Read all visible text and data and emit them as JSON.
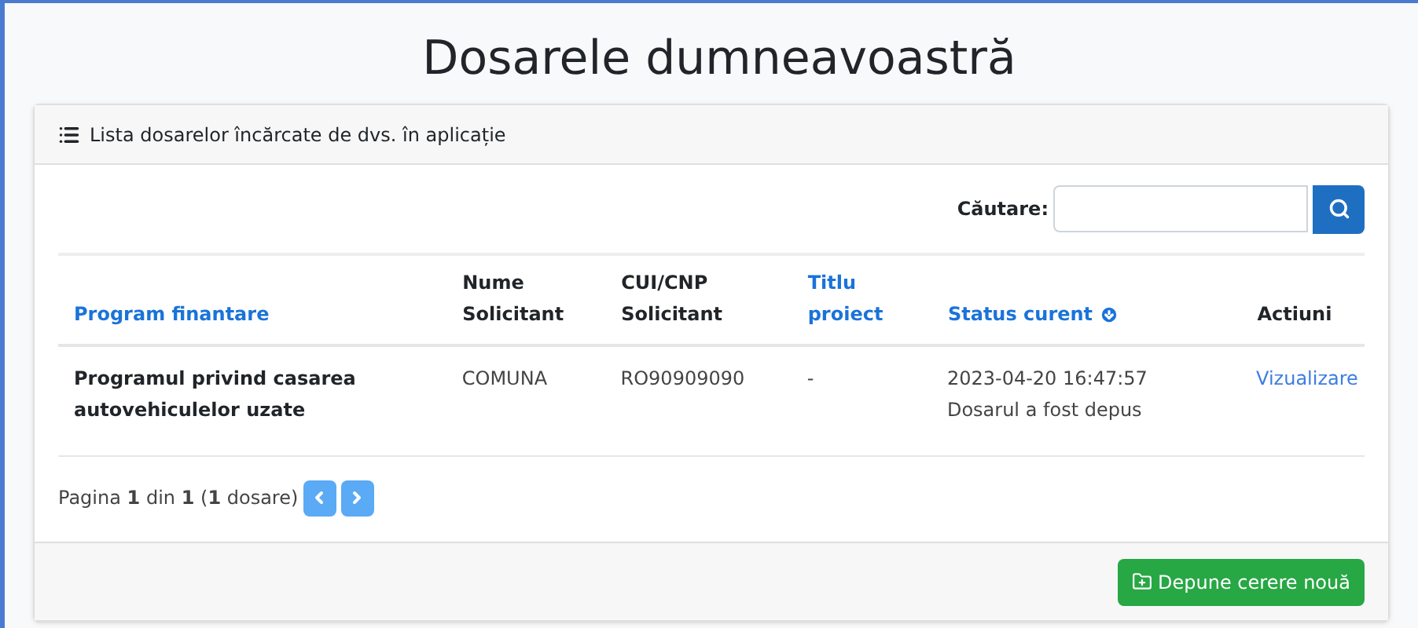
{
  "page_title": "Dosarele dumneavoastră",
  "card": {
    "header": "Lista dosarelor încărcate de dvs. în aplicație"
  },
  "search": {
    "label": "Căutare:"
  },
  "table": {
    "columns": [
      {
        "label": "Program finantare",
        "sortable": true,
        "sorted": false
      },
      {
        "label": "Nume Solicitant",
        "sortable": false,
        "sorted": false
      },
      {
        "label": "CUI/CNP Solicitant",
        "sortable": false,
        "sorted": false
      },
      {
        "label": "Titlu proiect",
        "sortable": true,
        "sorted": false
      },
      {
        "label": "Status curent",
        "sortable": true,
        "sorted": true
      },
      {
        "label": "Actiuni",
        "sortable": false,
        "sorted": false
      }
    ],
    "rows": [
      {
        "program": "Programul privind casarea autovehiculelor uzate",
        "name": "COMUNA",
        "cui": "RO90909090",
        "title": "-",
        "status": "2023-04-20 16:47:57 Dosarul a fost depus",
        "action": "Vizualizare"
      }
    ]
  },
  "pagination": {
    "text": "Pagina **1** din **1** (**1** dosare)"
  },
  "footer_button": "Depune cerere nouă"
}
